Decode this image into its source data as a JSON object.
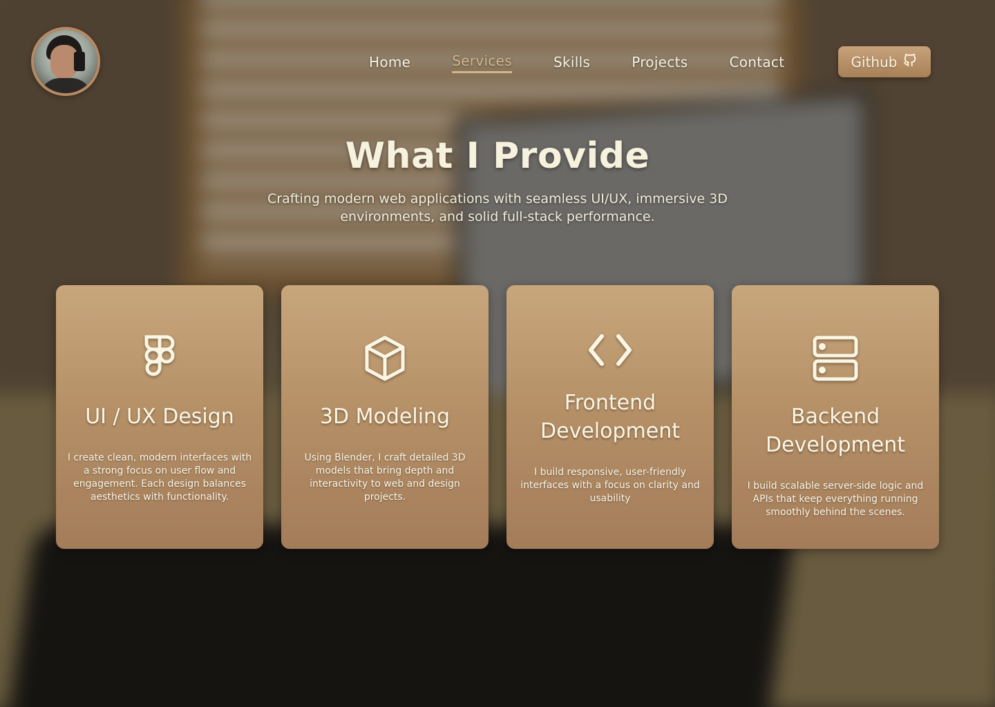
{
  "nav": {
    "items": [
      {
        "label": "Home",
        "active": false
      },
      {
        "label": "Services",
        "active": true
      },
      {
        "label": "Skills",
        "active": false
      },
      {
        "label": "Projects",
        "active": false
      },
      {
        "label": "Contact",
        "active": false
      }
    ],
    "github_label": "Github",
    "github_icon": "github-icon"
  },
  "hero": {
    "title": "What I Provide",
    "subtitle": "Crafting modern web applications with seamless UI/UX, immersive 3D environments, and solid full-stack performance."
  },
  "services": [
    {
      "icon": "figma-icon",
      "title": "UI / UX Design",
      "description": "I create clean, modern interfaces with a strong focus on user flow and engagement. Each design balances aesthetics with functionality."
    },
    {
      "icon": "cube-icon",
      "title": "3D Modeling",
      "description": "Using Blender, I craft detailed 3D models that bring depth and interactivity to web and design projects."
    },
    {
      "icon": "code-icon",
      "title": "Frontend Development",
      "description": "I build responsive, user-friendly interfaces with a focus on clarity and usability"
    },
    {
      "icon": "server-icon",
      "title": "Backend Development",
      "description": "I build scalable server-side logic and APIs that keep everything running smoothly behind the scenes."
    }
  ],
  "colors": {
    "accent": "#d4b48a",
    "card_top": "#c8a67c",
    "card_bottom": "#a47c5a",
    "text": "#f4efdc"
  }
}
